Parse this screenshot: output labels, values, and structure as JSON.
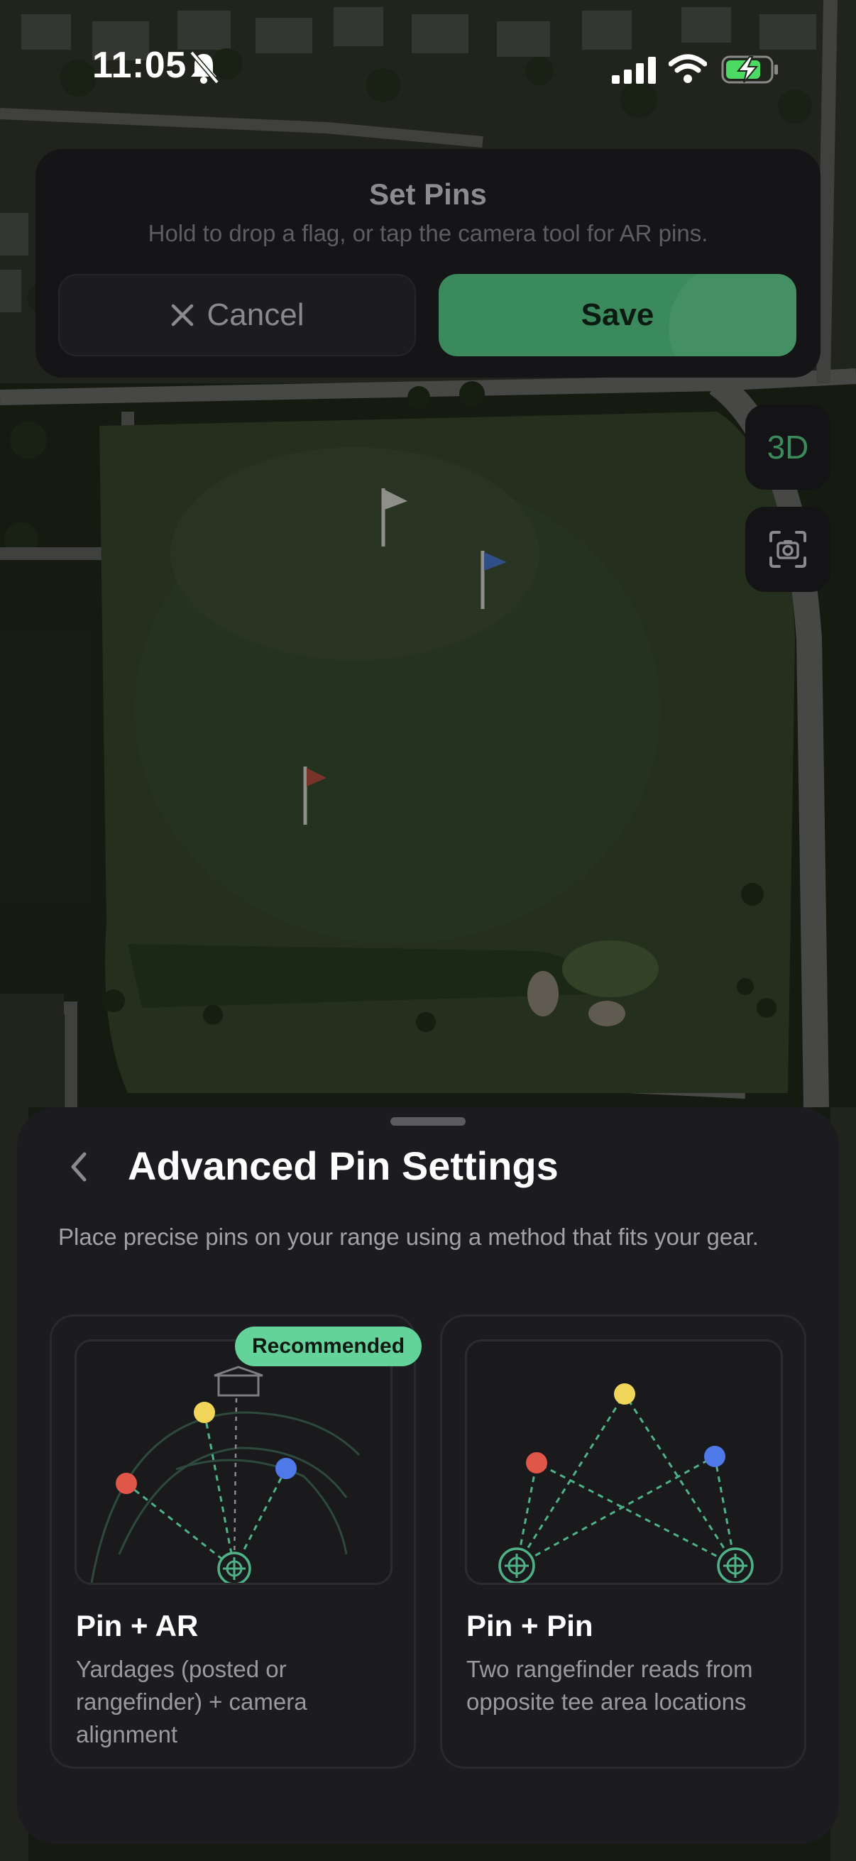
{
  "status_bar": {
    "time": "11:05"
  },
  "set_pins": {
    "title": "Set Pins",
    "subtitle": "Hold to drop a flag, or tap the camera tool for AR pins.",
    "cancel_label": "Cancel",
    "save_label": "Save"
  },
  "map_controls": {
    "toggle_3d_label": "3D"
  },
  "sheet": {
    "title": "Advanced Pin Settings",
    "description": "Place precise pins on your range using a method that fits your gear.",
    "options": [
      {
        "title": "Pin + AR",
        "description": "Yardages (posted or rangefinder) + camera alignment",
        "badge": "Recommended"
      },
      {
        "title": "Pin + Pin",
        "description": "Two rangefinder reads from opposite tee area locations"
      }
    ]
  },
  "colors": {
    "accent_green": "#3b8a5d",
    "badge_green": "#63d39a",
    "pin_red": "#e0574a",
    "pin_yellow": "#f2d65a",
    "pin_blue": "#4f78e8"
  }
}
